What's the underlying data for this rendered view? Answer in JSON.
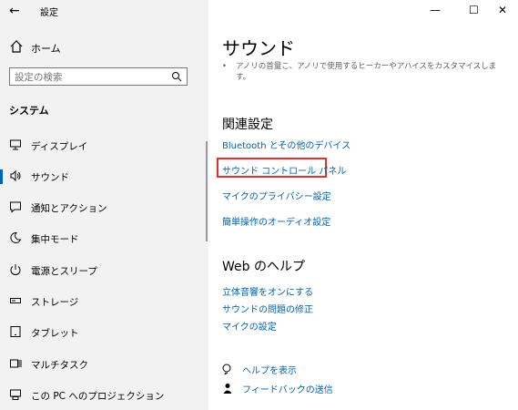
{
  "window": {
    "title": "設定",
    "back": "←",
    "minimize": "—",
    "maximize": "☐",
    "close": "✕"
  },
  "sidebar": {
    "home": "ホーム",
    "search_placeholder": "設定の検索",
    "section": "システム",
    "items": [
      {
        "label": "ディスプレイ",
        "icon": "monitor-icon"
      },
      {
        "label": "サウンド",
        "icon": "speaker-icon",
        "active": true
      },
      {
        "label": "通知とアクション",
        "icon": "notification-icon"
      },
      {
        "label": "集中モード",
        "icon": "moon-icon"
      },
      {
        "label": "電源とスリープ",
        "icon": "power-icon"
      },
      {
        "label": "ストレージ",
        "icon": "storage-icon"
      },
      {
        "label": "タブレット",
        "icon": "tablet-icon"
      },
      {
        "label": "マルチタスク",
        "icon": "multitask-icon"
      },
      {
        "label": "この PC へのプロジェクション",
        "icon": "projection-icon"
      }
    ]
  },
  "main": {
    "title": "サウンド",
    "partial_line1": "アノリの首量こ、アノリで使用するヒーカーやアハイスをカスタマイスしま",
    "partial_line2": "す。",
    "related_heading": "関連設定",
    "related_links": [
      "Bluetooth とその他のデバイス",
      "サウンド コントロール パネル",
      "マイクのプライバシー設定",
      "簡単操作のオーディオ設定"
    ],
    "web_help_heading": "Web のヘルプ",
    "web_help_links": [
      "立体音響をオンにする",
      "サウンドの問題の修正",
      "マイクの設定"
    ],
    "help_show": "ヘルプを表示",
    "feedback": "フィードバックの送信"
  },
  "colors": {
    "accent": "#0063b1",
    "highlight": "#e03030",
    "sidebar_bg": "#f2f2f2"
  }
}
